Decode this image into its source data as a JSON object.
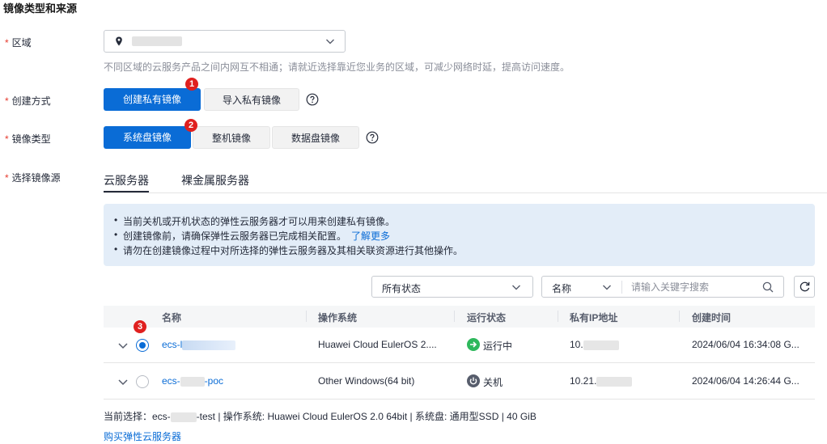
{
  "section_title": "镜像类型和来源",
  "region": {
    "label": "区域",
    "hint": "不同区域的云服务产品之间内网互不相通；请就近选择靠近您业务的区域，可减少网络时延，提高访问速度。"
  },
  "create_method": {
    "label": "创建方式",
    "options": [
      "创建私有镜像",
      "导入私有镜像"
    ],
    "selected": "创建私有镜像",
    "badge": "1"
  },
  "image_type": {
    "label": "镜像类型",
    "options": [
      "系统盘镜像",
      "整机镜像",
      "数据盘镜像"
    ],
    "selected": "系统盘镜像",
    "badge": "2"
  },
  "image_source": {
    "label": "选择镜像源",
    "tabs": [
      "云服务器",
      "裸金属服务器"
    ],
    "active_tab": "云服务器"
  },
  "info": {
    "lines": [
      "当前关机或开机状态的弹性云服务器才可以用来创建私有镜像。",
      "创建镜像前，请确保弹性云服务器已完成相关配置。",
      "请勿在创建镜像过程中对所选择的弹性云服务器及其相关联资源进行其他操作。"
    ],
    "link": "了解更多"
  },
  "filters": {
    "status_value": "所有状态",
    "search_key": "名称",
    "search_placeholder": "请输入关键字搜索"
  },
  "table": {
    "columns": [
      "名称",
      "操作系统",
      "运行状态",
      "私有IP地址",
      "创建时间"
    ],
    "badge": "3",
    "rows": [
      {
        "name_prefix": "ecs-l",
        "name_suffix": "",
        "os": "Huawei Cloud EulerOS 2....",
        "status": "运行中",
        "ip": "10.",
        "created": "2024/06/04 16:34:08 G...",
        "selected": true
      },
      {
        "name_prefix": "ecs-",
        "name_suffix": "-poc",
        "os": "Other Windows(64 bit)",
        "status": "关机",
        "ip": "10.21.",
        "created": "2024/06/04 14:26:44 G...",
        "selected": false
      }
    ]
  },
  "current_selection": {
    "prefix": "当前选择：ecs-",
    "suffix": "-test | 操作系统: Huawei Cloud EulerOS 2.0 64bit | 系统盘: 通用型SSD | 40 GiB"
  },
  "buy_link": "购买弹性云服务器",
  "colors": {
    "primary": "#0a6cd6",
    "required": "#e63b2e",
    "badge": "#e0201f",
    "running": "#2eb85c",
    "stopped": "#575d6c"
  }
}
